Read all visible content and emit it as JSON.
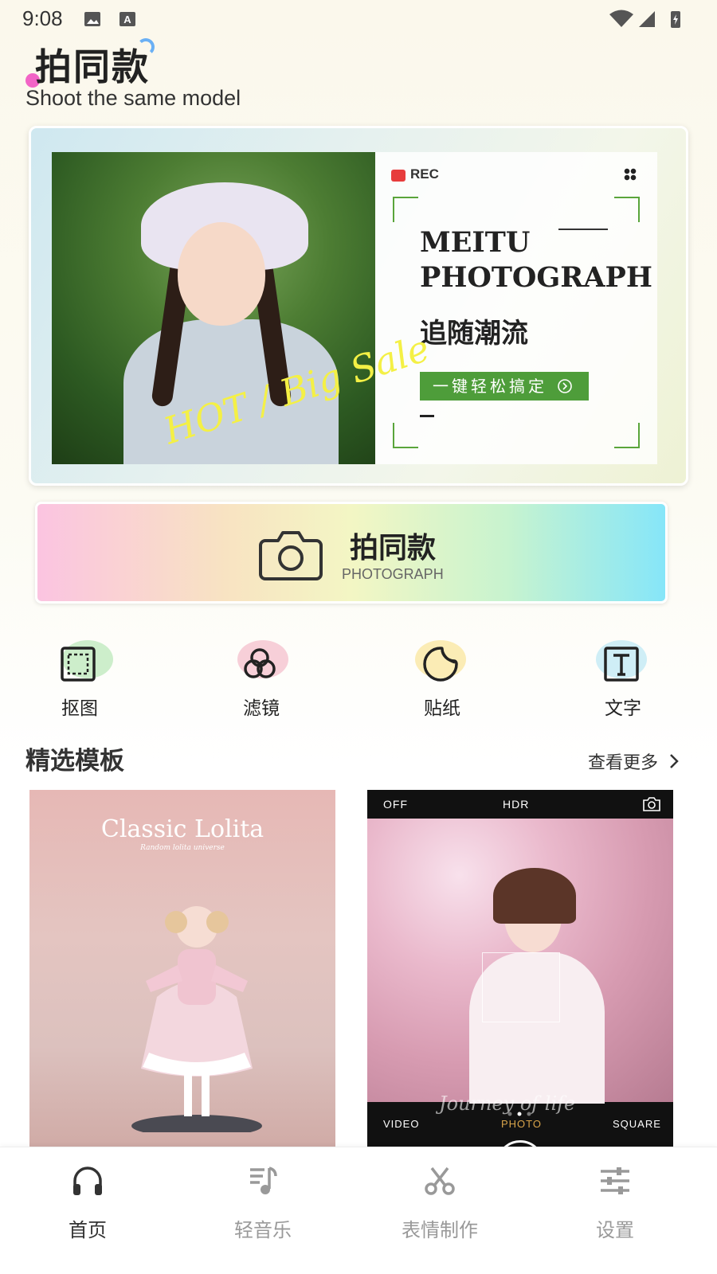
{
  "status_bar": {
    "time": "9:08"
  },
  "header": {
    "title": "拍同款",
    "subtitle": "Shoot the same model"
  },
  "banner": {
    "rec_label": "REC",
    "headline": "MEITU\nPHOTOGRAPH",
    "slogan": "追随潮流",
    "cta": "一键轻松搞定",
    "sticker": "HOT / Big Sale"
  },
  "photo_button": {
    "title": "拍同款",
    "subtitle": "PHOTOGRAPH"
  },
  "tools": [
    {
      "label": "抠图",
      "icon": "cutout-icon",
      "color": "#cdeecb"
    },
    {
      "label": "滤镜",
      "icon": "filter-icon",
      "color": "#f7cfd8"
    },
    {
      "label": "贴纸",
      "icon": "sticker-icon",
      "color": "#fbecb5"
    },
    {
      "label": "文字",
      "icon": "text-icon",
      "color": "#cfeef6"
    }
  ],
  "section": {
    "title": "精选模板",
    "view_more": "查看更多"
  },
  "templates": [
    {
      "title": "Classic Lolita",
      "subtitle": "Random lolita universe"
    },
    {
      "top_left": "OFF",
      "top_center": "HDR",
      "modes": [
        "VIDEO",
        "PHOTO",
        "SQUARE"
      ],
      "active_mode": "PHOTO",
      "script": "Journey of life"
    }
  ],
  "bottom_nav": [
    {
      "label": "首页",
      "icon": "headphones-icon",
      "active": true
    },
    {
      "label": "轻音乐",
      "icon": "music-icon",
      "active": false
    },
    {
      "label": "表情制作",
      "icon": "scissors-icon",
      "active": false
    },
    {
      "label": "设置",
      "icon": "sliders-icon",
      "active": false
    }
  ],
  "colors": {
    "accent_green": "#4e9d3a",
    "rec_red": "#e73c3c",
    "active_mode": "#d9a44a"
  }
}
